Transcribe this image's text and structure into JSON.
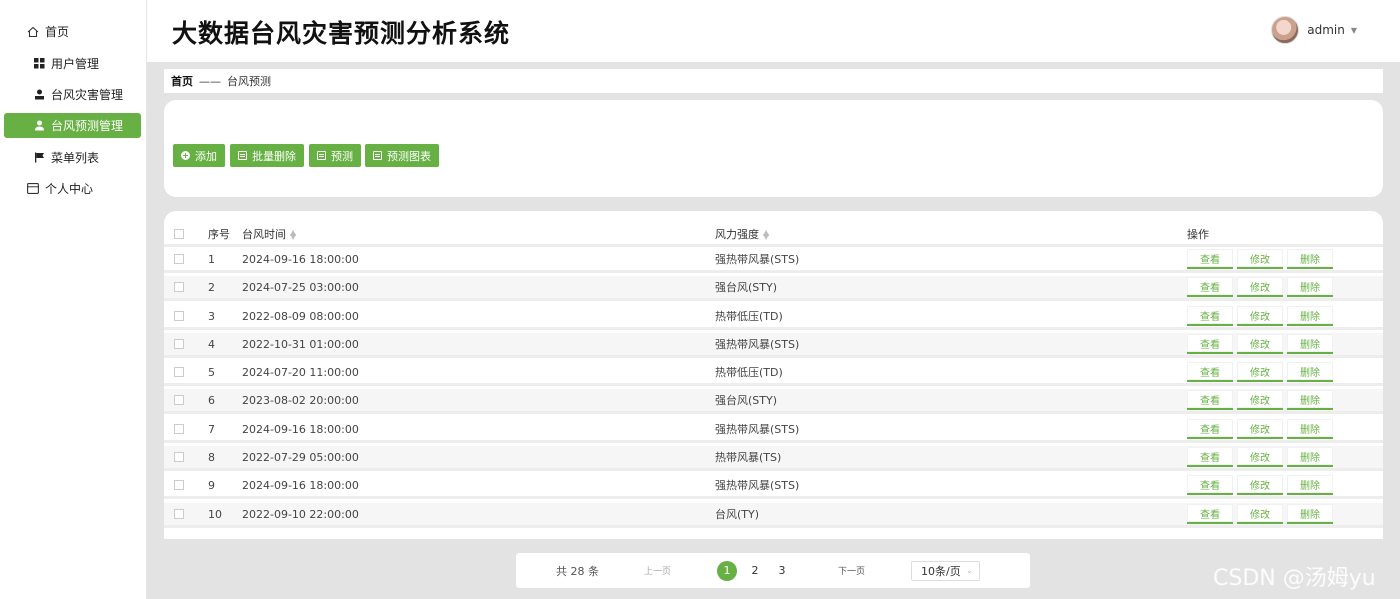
{
  "app": {
    "title": "大数据台风灾害预测分析系统"
  },
  "user": {
    "name": "admin"
  },
  "sidebar": {
    "items": [
      {
        "label": "首页",
        "icon": "home-icon"
      },
      {
        "label": "用户管理",
        "icon": "grid-icon"
      },
      {
        "label": "台风灾害管理",
        "icon": "person-icon"
      },
      {
        "label": "台风预测管理",
        "icon": "person-icon",
        "active": true
      },
      {
        "label": "菜单列表",
        "icon": "flag-icon"
      },
      {
        "label": "个人中心",
        "icon": "card-icon"
      }
    ]
  },
  "breadcrumb": {
    "home": "首页",
    "separator": "——",
    "current": "台风预测"
  },
  "toolbar": {
    "add": "添加",
    "batch_delete": "批量删除",
    "predict": "预测",
    "predict_chart": "预测图表"
  },
  "table": {
    "headers": {
      "no": "序号",
      "time": "台风时间",
      "wind": "风力强度",
      "ops": "操作"
    },
    "rows": [
      {
        "no": "1",
        "time": "2024-09-16 18:00:00",
        "wind": "强热带风暴(STS)"
      },
      {
        "no": "2",
        "time": "2024-07-25 03:00:00",
        "wind": "强台风(STY)"
      },
      {
        "no": "3",
        "time": "2022-08-09 08:00:00",
        "wind": "热带低压(TD)"
      },
      {
        "no": "4",
        "time": "2022-10-31 01:00:00",
        "wind": "强热带风暴(STS)"
      },
      {
        "no": "5",
        "time": "2024-07-20 11:00:00",
        "wind": "热带低压(TD)"
      },
      {
        "no": "6",
        "time": "2023-08-02 20:00:00",
        "wind": "强台风(STY)"
      },
      {
        "no": "7",
        "time": "2024-09-16 18:00:00",
        "wind": "强热带风暴(STS)"
      },
      {
        "no": "8",
        "time": "2022-07-29 05:00:00",
        "wind": "热带风暴(TS)"
      },
      {
        "no": "9",
        "time": "2024-09-16 18:00:00",
        "wind": "强热带风暴(STS)"
      },
      {
        "no": "10",
        "time": "2022-09-10 22:00:00",
        "wind": "台风(TY)"
      }
    ],
    "ops": {
      "view": "查看",
      "edit": "修改",
      "delete": "删除"
    }
  },
  "pagination": {
    "total": "共 28 条",
    "prev": "上一页",
    "pages": [
      "1",
      "2",
      "3"
    ],
    "current": "1",
    "next": "下一页",
    "page_size": "10条/页"
  },
  "watermark": "CSDN @汤姆yu",
  "colors": {
    "accent": "#67b044"
  }
}
